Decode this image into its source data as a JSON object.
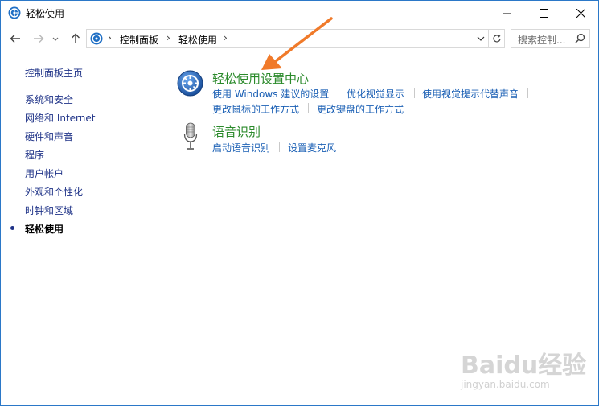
{
  "window": {
    "title": "轻松使用",
    "icon": "ease-of-access-icon"
  },
  "titlebar_buttons": [
    "minimize-icon",
    "maximize-icon",
    "close-icon"
  ],
  "nav": {
    "back_icon": "arrow-left-icon",
    "forward_icon": "arrow-right-icon",
    "history_icon": "chevron-down-icon",
    "up_icon": "arrow-up-icon"
  },
  "address": {
    "crumbs": [
      "控制面板",
      "轻松使用"
    ],
    "refresh_icon": "refresh-icon",
    "dropdown_icon": "chevron-down-icon"
  },
  "search": {
    "placeholder": "搜索控制...",
    "icon": "search-icon"
  },
  "sidebar": {
    "home": "控制面板主页",
    "items": [
      {
        "label": "系统和安全"
      },
      {
        "label": "网络和 Internet"
      },
      {
        "label": "硬件和声音"
      },
      {
        "label": "程序"
      },
      {
        "label": "用户帐户"
      },
      {
        "label": "外观和个性化"
      },
      {
        "label": "时钟和区域"
      },
      {
        "label": "轻松使用",
        "current": true
      }
    ]
  },
  "categories": [
    {
      "title": "轻松使用设置中心",
      "icon": "ease-of-access-center-icon",
      "links_row1": [
        "使用 Windows 建议的设置",
        "优化视觉显示",
        "使用视觉提示代替声音"
      ],
      "links_row2": [
        "更改鼠标的工作方式",
        "更改键盘的工作方式"
      ]
    },
    {
      "title": "语音识别",
      "icon": "microphone-icon",
      "links_row1": [
        "启动语音识别",
        "设置麦克风"
      ]
    }
  ],
  "annotation": {
    "icon": "orange-arrow-icon",
    "color": "#f07a2a"
  },
  "watermark": {
    "brand": "Baidu经验",
    "url": "jingyan.baidu.com"
  },
  "colors": {
    "link": "#1a5fb4",
    "category_title": "#2b8a2b",
    "sidebar_link": "#1e3287",
    "window_border": "#2b78c8"
  }
}
